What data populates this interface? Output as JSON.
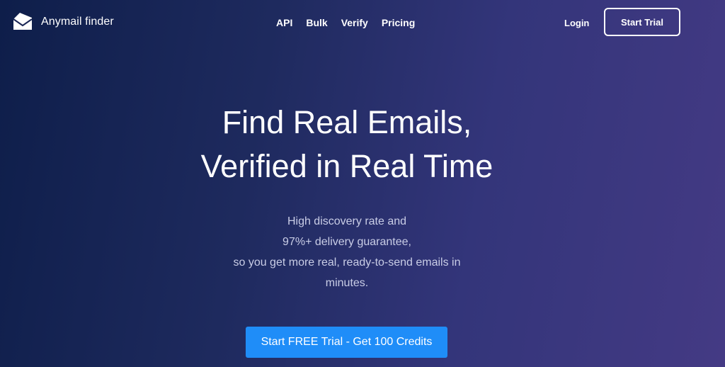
{
  "header": {
    "brand_name": "Anymail finder",
    "logo_icon": "envelope-icon",
    "nav_items": [
      "API",
      "Bulk",
      "Verify",
      "Pricing"
    ],
    "login_label": "Login",
    "start_trial_label": "Start Trial"
  },
  "hero": {
    "title_line1": "Find Real Emails,",
    "title_line2": "Verified in Real Time",
    "subtitle_lines": [
      "High discovery rate and",
      "97%+ delivery guarantee,",
      "so you get more real, ready-to-send emails in",
      "minutes."
    ],
    "cta_label": "Start FREE Trial - Get 100 Credits"
  },
  "colors": {
    "background_start": "#0e1e4a",
    "background_end": "#443a84",
    "cta": "#1f8df8",
    "subtitle_text": "#c9cde6"
  }
}
